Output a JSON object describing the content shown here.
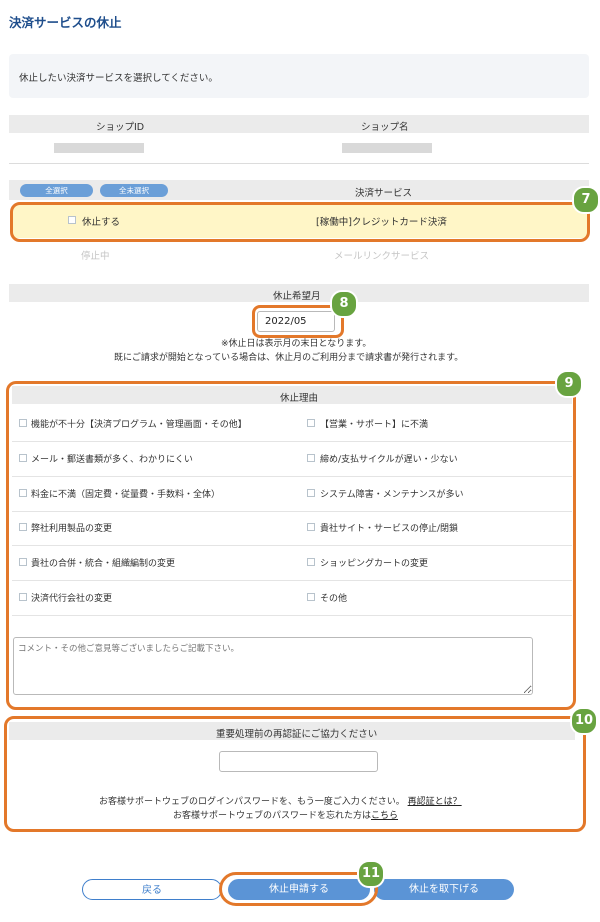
{
  "page": {
    "title": "決済サービスの休止",
    "intro": "休止したい決済サービスを選択してください。"
  },
  "shop_table": {
    "col_id": "ショップID",
    "col_name": "ショップ名"
  },
  "service_table": {
    "select_all": "全選択",
    "deselect_all": "全未選択",
    "col_service": "決済サービス",
    "rows": [
      {
        "check_label": "休止する",
        "service": "[稼働中]クレジットカード決済"
      },
      {
        "status": "停止中",
        "service": "メールリンクサービス"
      }
    ]
  },
  "badges": [
    "7",
    "8",
    "9",
    "10",
    "11"
  ],
  "month": {
    "header": "休止希望月",
    "value": "2022/05",
    "note1": "※休止日は表示月の末日となります。",
    "note2": "既にご請求が開始となっている場合は、休止月のご利用分まで請求書が発行されます。"
  },
  "reasons": {
    "header": "休止理由",
    "items": [
      "機能が不十分【決済プログラム・管理画面・その他】",
      "【営業・サポート】に不満",
      "メール・郵送書類が多く、わかりにくい",
      "締め/支払サイクルが遅い・少ない",
      "料金に不満（固定費・従量費・手数料・全体）",
      "システム障害・メンテナンスが多い",
      "弊社利用製品の変更",
      "貴社サイト・サービスの停止/閉鎖",
      "貴社の合併・統合・組織編制の変更",
      "ショッピングカートの変更",
      "決済代行会社の変更",
      "その他"
    ],
    "comment_placeholder": "コメント・その他ご意見等ございましたらご記載下さい。"
  },
  "reauth": {
    "header": "重要処理前の再認証にご協力ください",
    "text": "お客様サポートウェブのログインパスワードを、もう一度ご入力ください。",
    "link1": "再認証とは？",
    "text2": "お客様サポートウェブのパスワードを忘れた方は",
    "link2": "こちら"
  },
  "buttons": {
    "back": "戻る",
    "submit": "休止申請する",
    "cancel": "休止を取下げる"
  },
  "colors": {
    "accent": "#3f7fcc",
    "highlight_border": "#e3782a",
    "badge": "#68a340",
    "row_highlight": "#fff6c7"
  }
}
